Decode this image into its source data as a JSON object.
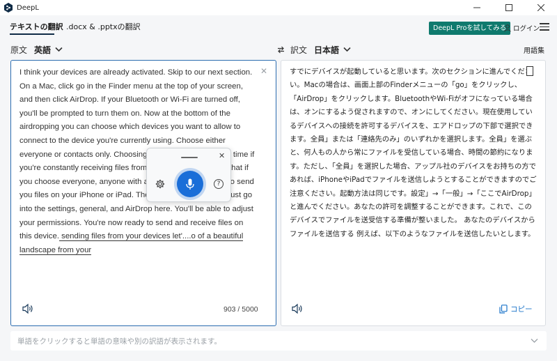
{
  "window": {
    "title": "DeepL"
  },
  "tabs": [
    {
      "label": "テキストの翻訳"
    },
    {
      "label": ".docx & .pptxの翻訳"
    }
  ],
  "header": {
    "pro_button": "DeepL Proを試してみる",
    "login": "ログイン"
  },
  "source": {
    "label": "原文",
    "language": "英語",
    "text": "I think your devices are already activated. Skip to our next section. On a Mac, click go in the Finder menu at the top of your screen, and then click AirDrop. If your Bluetooth or Wi-Fi are turned off, you'll be prompted to turn them on. Now at the bottom of the airdropping you can choose which devices you want to allow to connect to the device you're currently using. Choose either everyone or contacts only. Choosing everyone can save you time if you're constantly receiving files from people. Just be aware that if you choose everyone, anyone with an Apple device can try to send you files on your iPhone or iPad. The process is the same. Just go into the settings, general, and AirDrop here. You'll be able to adjust your permissions. You're now ready to send and receive files on this device.",
    "text_tail": " sending files from your devices let'....o of a beautiful landscape from your",
    "char_count": "903 / 5000"
  },
  "target": {
    "label": "訳文",
    "language": "日本語",
    "glossary": "用語集",
    "text": "すでにデバイスが起動していると思います。次のセクションに進んでください。Macの場合は、画面上部のFinderメニューの「go」をクリックし、「AirDrop」をクリックします。BluetoothやWi-Fiがオフになっている場合は、オンにするよう促されますので、オンにしてください。現在使用しているデバイスへの接続を許可するデバイスを、エアドロップの下部で選択できます。全員」または「連絡先のみ」のいずれかを選択します。全員」を選ぶと、何人もの人から常にファイルを受信している場合、時間の節約になります。ただし、「全員」を選択した場合、アップル社のデバイスをお持ちの方であれば、iPhoneやiPadでファイルを送信しようとすることができますのでご注意ください。起動方法は同じです。設定」→「一般」→「ここでAirDrop」と進んでください。あなたの許可を調整することができます。これで、このデバイスでファイルを送受信する準備が整いました。 あなたのデバイスからファイルを送信する 例えば、以下のようなファイルを送信したいとします。",
    "copy_label": "コピー"
  },
  "footer": {
    "hint": "単語をクリックすると単語の意味や別の訳語が表示されます。"
  },
  "icons": {
    "close": "✕",
    "chevron": "⌄",
    "swap": "⇄",
    "help": "?"
  },
  "colors": {
    "accent": "#1a6ed8",
    "pro": "#0f7a6e",
    "brand_dark": "#0f2b46"
  }
}
